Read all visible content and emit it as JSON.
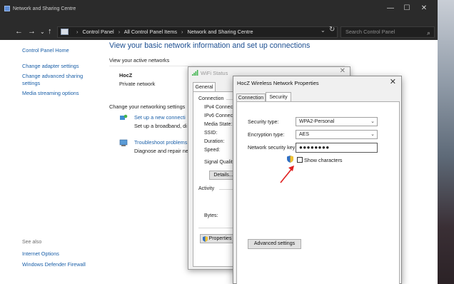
{
  "window": {
    "title": "Network and Sharing Centre",
    "controls": [
      "—",
      "☐",
      "✕"
    ]
  },
  "nav": {
    "back": "←",
    "forward": "→",
    "recent": "⌄",
    "up": "↑",
    "breadcrumb": [
      "Control Panel",
      "All Control Panel Items",
      "Network and Sharing Centre"
    ],
    "separator": "›",
    "dropdown": "⌄",
    "refresh": "↻",
    "search_placeholder": "Search Control Panel",
    "search_icon": "⌕"
  },
  "sidebar": {
    "home": "Control Panel Home",
    "items": [
      "Change adapter settings",
      "Change advanced sharing settings",
      "Media streaming options"
    ],
    "item2_line1": "Change advanced sharing",
    "item2_line2": "settings",
    "see_also": {
      "header": "See also",
      "links": [
        "Internet Options",
        "Windows Defender Firewall"
      ]
    }
  },
  "main": {
    "title": "View your basic network information and set up connections",
    "active_networks_header": "View your active networks",
    "network_name": "HocZ",
    "network_type": "Private network",
    "settings_header": "Change your networking settings",
    "task1_link": "Set up a new connecti",
    "task1_desc": "Set up a broadband, di",
    "task2_link": "Troubleshoot problems",
    "task2_desc": "Diagnose and repair ne"
  },
  "wifi_status": {
    "title": "WiFi Status",
    "close": "✕",
    "tab": "General",
    "connection_header": "Connection",
    "fields": [
      "IPv4 Connect",
      "IPv6 Connect",
      "Media State:",
      "SSID:",
      "Duration:",
      "Speed:"
    ],
    "signal_quality": "Signal Quality",
    "details_button": "Details...",
    "activity_header": "Activity",
    "bytes_label": "Bytes:",
    "properties_button": "Properties"
  },
  "properties": {
    "title": "HocZ Wireless Network Properties",
    "close": "✕",
    "tabs": [
      "Connection",
      "Security"
    ],
    "security_type_label": "Security type:",
    "security_type_value": "WPA2-Personal",
    "encryption_type_label": "Encryption type:",
    "encryption_type_value": "AES",
    "key_label": "Network security key",
    "key_value": "●●●●●●●●",
    "show_characters": "Show characters",
    "advanced_button": "Advanced settings"
  },
  "colors": {
    "title_bar": "#2b2b2b",
    "link": "#1a5fa8",
    "heading": "#1d4f91",
    "annotation_arrow": "#e02020"
  }
}
